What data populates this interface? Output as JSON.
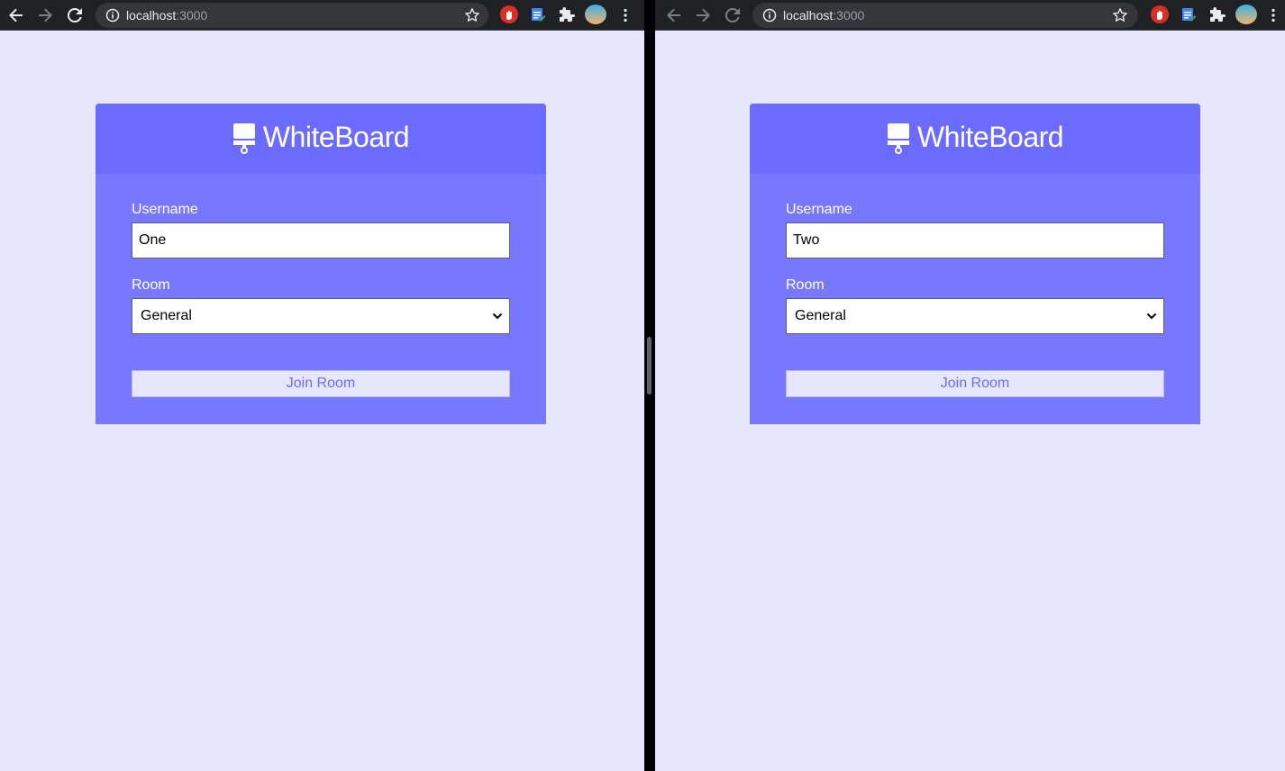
{
  "windows": [
    {
      "url_host": "localhost",
      "url_port": ":3000",
      "app_title": "WhiteBoard",
      "username_label": "Username",
      "username_value": "One",
      "room_label": "Room",
      "room_value": "General",
      "join_label": "Join Room"
    },
    {
      "url_host": "localhost",
      "url_port": ":3000",
      "app_title": "WhiteBoard",
      "username_label": "Username",
      "username_value": "Two",
      "room_label": "Room",
      "room_value": "General",
      "join_label": "Join Room"
    }
  ],
  "colors": {
    "page_bg": "#e6e6ff",
    "card_header": "#6b6bff",
    "card_body": "#7878ff",
    "toolbar": "#202124"
  },
  "icons": [
    "back-icon",
    "forward-icon",
    "reload-icon",
    "info-icon",
    "bookmark-star-icon",
    "extension-icon",
    "menu-icon",
    "whiteboard-icon",
    "chevron-down-icon"
  ]
}
